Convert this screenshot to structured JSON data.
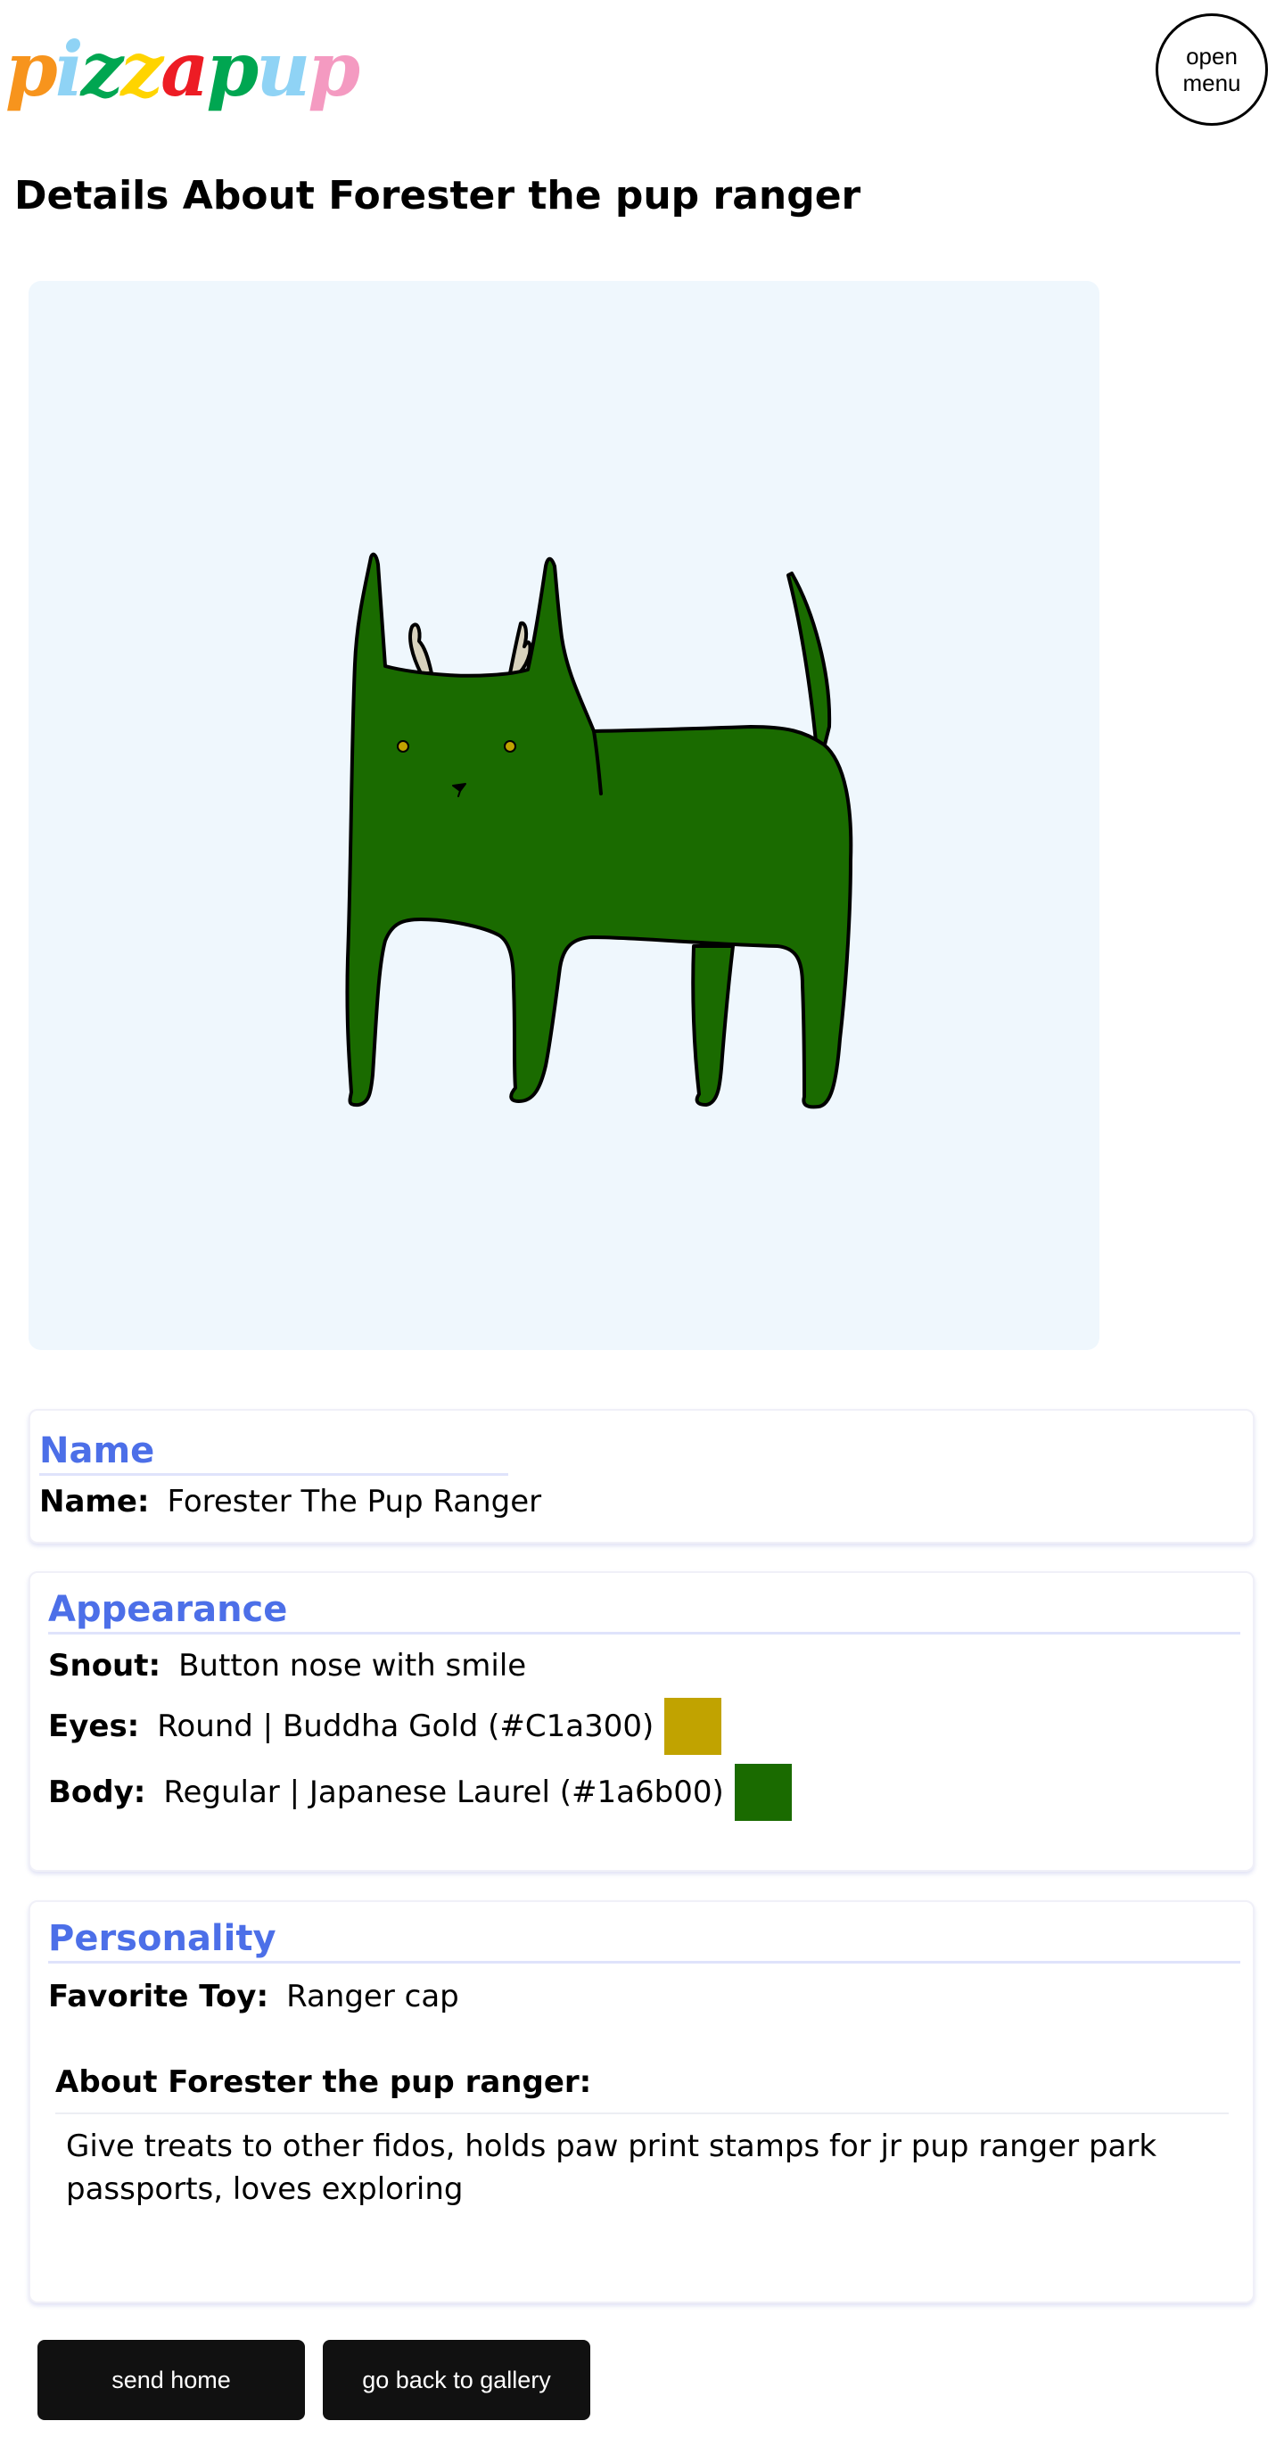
{
  "header": {
    "logo_letters": [
      {
        "char": "p",
        "color": "#f7941d"
      },
      {
        "char": "i",
        "color": "#8fd3f5"
      },
      {
        "char": "z",
        "color": "#00a651"
      },
      {
        "char": "z",
        "color": "#ffd400"
      },
      {
        "char": "a",
        "color": "#ed1c24"
      },
      {
        "char": "p",
        "color": "#00a651"
      },
      {
        "char": "u",
        "color": "#8fd3f5"
      },
      {
        "char": "p",
        "color": "#f49ac1"
      }
    ],
    "logo_text": "pizzapup",
    "menu_button_label_line1": "open",
    "menu_button_label_line2": "menu"
  },
  "page_title": "Details About Forester the pup ranger",
  "pup_image": {
    "body_color": "#1a6b00",
    "eye_color": "#C1a300",
    "antler_color": "#d8d2bd",
    "background": "#eff7fd"
  },
  "name_section": {
    "heading": "Name",
    "label": "Name:",
    "value": "Forester The Pup Ranger"
  },
  "appearance_section": {
    "heading": "Appearance",
    "snout": {
      "label": "Snout:",
      "value": "Button nose with smile"
    },
    "eyes": {
      "label": "Eyes:",
      "value": "Round | Buddha Gold (#C1a300)",
      "swatch": "#C1a300"
    },
    "body": {
      "label": "Body:",
      "value": "Regular | Japanese Laurel (#1a6b00)",
      "swatch": "#1a6b00"
    }
  },
  "personality_section": {
    "heading": "Personality",
    "favorite_toy": {
      "label": "Favorite Toy:",
      "value": "Ranger cap"
    },
    "about_label": "About Forester the pup ranger:",
    "about_text": "Give treats to other fidos, holds paw print stamps for jr pup ranger park passports, loves exploring"
  },
  "actions": {
    "send_home_label": "send home",
    "back_to_gallery_label": "go back to gallery"
  }
}
